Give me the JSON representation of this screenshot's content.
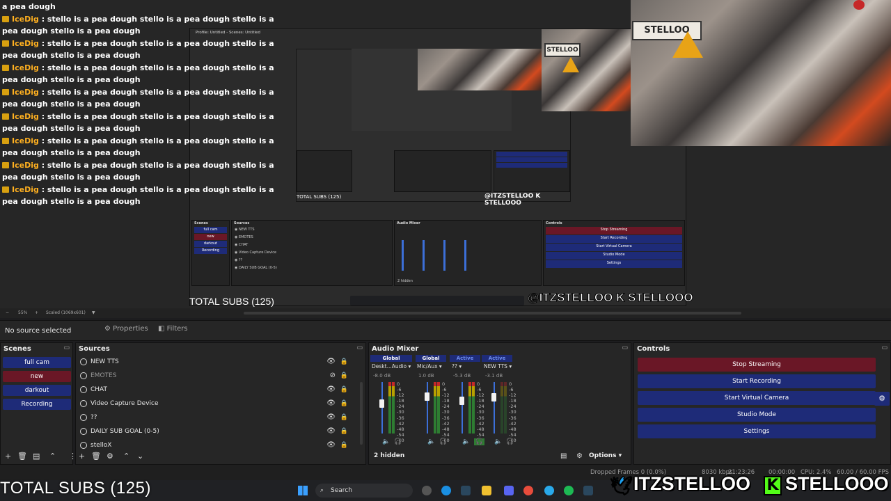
{
  "chat": {
    "messages": [
      {
        "user": "IceDig",
        "text": "stello is a pea dough stello is a pea dough stello is a pea dough stello is a pea dough"
      },
      {
        "user": "IceDig",
        "text": "stello is a pea dough stello is a pea dough stello is a pea dough stello is a pea dough"
      },
      {
        "user": "IceDig",
        "text": "stello is a pea dough stello is a pea dough stello is a pea dough stello is a pea dough"
      },
      {
        "user": "IceDig",
        "text": "stello is a pea dough stello is a pea dough stello is a pea dough stello is a pea dough"
      },
      {
        "user": "IceDig",
        "text": "stello is a pea dough stello is a pea dough stello is a pea dough stello is a pea dough"
      },
      {
        "user": "IceDig",
        "text": "stello is a pea dough stello is a pea dough stello is a pea dough stello is a pea dough"
      },
      {
        "user": "IceDig",
        "text": "stello is a pea dough stello is a pea dough stello is a pea dough stello is a pea dough"
      },
      {
        "user": "IceDig",
        "text": "stello is a pea dough stello is a pea dough stello is a pea dough stello is a pea dough"
      }
    ],
    "top_line": "a pea dough"
  },
  "nested": {
    "window_title": "Profile: Untitled - Scenes: Untitled",
    "subs": "TOTAL SUBS (125)",
    "handles": "@ITZSTELLOO K STELLOOO"
  },
  "zoom": {
    "level": "55%",
    "mode": "Scaled (1069x601)"
  },
  "context": {
    "no_source": "No source selected",
    "properties": "Properties",
    "filters": "Filters"
  },
  "scenes": {
    "title": "Scenes",
    "items": [
      {
        "label": "full cam",
        "active": false
      },
      {
        "label": "new",
        "active": true
      },
      {
        "label": "darkout",
        "active": false
      },
      {
        "label": "Recording",
        "active": false
      }
    ]
  },
  "sources": {
    "title": "Sources",
    "items": [
      {
        "label": "NEW TTS",
        "icon": "globe-icon",
        "visible": true
      },
      {
        "label": "EMOTES",
        "icon": "globe-icon",
        "visible": false
      },
      {
        "label": "CHAT",
        "icon": "globe-icon",
        "visible": true
      },
      {
        "label": "Video Capture Device",
        "icon": "camera-icon",
        "visible": true
      },
      {
        "label": "??",
        "icon": "globe-icon",
        "visible": true
      },
      {
        "label": "DAILY SUB GOAL (0-5)",
        "icon": "text-icon",
        "visible": true
      },
      {
        "label": "stelloX",
        "icon": "image-icon",
        "visible": true
      }
    ]
  },
  "mixer": {
    "title": "Audio Mixer",
    "headers": [
      "Global",
      "Global",
      "Active",
      "Active"
    ],
    "channels": [
      {
        "name": "Deskt...Audio",
        "db": "-8.0 dB",
        "level": 0.66
      },
      {
        "name": "Mic/Aux",
        "db": "1.0 dB",
        "level": 0.8
      },
      {
        "name": "??",
        "db": "-5.3 dB",
        "level": 0.72
      },
      {
        "name": "NEW TTS",
        "db": "-3.1 dB",
        "level": 0.78
      }
    ],
    "scale": [
      "0",
      "-6",
      "-12",
      "-18",
      "-24",
      "-30",
      "-36",
      "-42",
      "-48",
      "-54",
      "-60"
    ],
    "hidden": "2 hidden",
    "options": "Options"
  },
  "controls": {
    "title": "Controls",
    "stop_streaming": "Stop Streaming",
    "start_recording": "Start Recording",
    "start_virtual_camera": "Start Virtual Camera",
    "studio_mode": "Studio Mode",
    "settings": "Settings"
  },
  "status": {
    "dropped": "Dropped Frames 0 (0.0%)",
    "kbps": "8030 kbps",
    "live_time": "21:23:26",
    "rec_time": "00:00:00",
    "cpu": "CPU: 2.4%",
    "fps": "60.00 / 60.00 FPS"
  },
  "taskbar": {
    "search": "Search"
  },
  "overlay": {
    "subs": "TOTAL SUBS (125)",
    "twitter": "ITZSTELLOO",
    "kick": "STELLOOO"
  },
  "colors": {
    "accent_blue": "#1e2b78",
    "accent_red": "#6a1726"
  }
}
